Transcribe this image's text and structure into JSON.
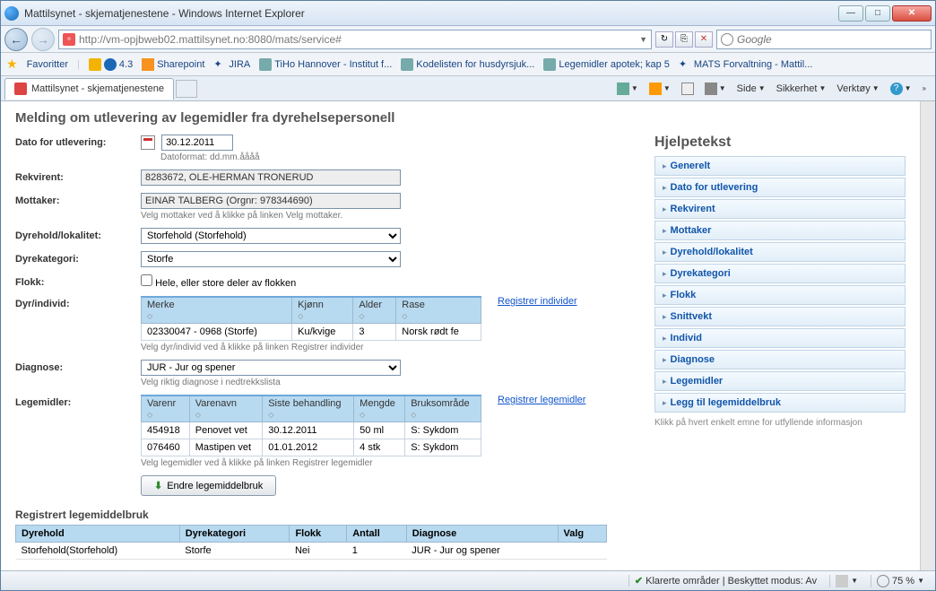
{
  "window": {
    "title": "Mattilsynet - skjematjenestene - Windows Internet Explorer",
    "url": "http://vm-opjbweb02.mattilsynet.no:8080/mats/service#",
    "search_placeholder": "Google"
  },
  "bookmarks": {
    "fav_label": "Favoritter",
    "items": [
      "4.3",
      "Sharepoint",
      "JIRA",
      "TiHo Hannover - Institut f...",
      "Kodelisten for husdyrsjuk...",
      "Legemidler apotek; kap 5",
      "MATS Forvaltning - Mattil..."
    ]
  },
  "tab": {
    "title": "Mattilsynet - skjematjenestene"
  },
  "toolbar": {
    "items": [
      "Side",
      "Sikkerhet",
      "Verktøy"
    ]
  },
  "page": {
    "title": "Melding om utlevering av legemidler fra dyrehelsepersonell",
    "labels": {
      "dato": "Dato for utlevering:",
      "dato_value": "30.12.2011",
      "dato_help": "Datoformat: dd.mm.åååå",
      "rekvirent": "Rekvirent:",
      "rekvirent_value": "8283672, OLE-HERMAN TRONERUD",
      "mottaker": "Mottaker:",
      "mottaker_value": "EINAR TALBERG (Orgnr: 978344690)",
      "mottaker_help": "Velg mottaker ved å klikke på linken Velg mottaker.",
      "dyrehold": "Dyrehold/lokalitet:",
      "dyrehold_value": "Storfehold (Storfehold)",
      "kategori": "Dyrekategori:",
      "kategori_value": "Storfe",
      "flokk": "Flokk:",
      "flokk_text": "Hele, eller store deler av flokken",
      "individ": "Dyr/individ:",
      "individ_link": "Registrer individer",
      "individ_help": "Velg dyr/individ ved å klikke på linken Registrer individer",
      "diagnose": "Diagnose:",
      "diagnose_value": "JUR - Jur og spener",
      "diagnose_help": "Velg riktig diagnose i nedtrekkslista",
      "legemidler": "Legemidler:",
      "legemidler_link": "Registrer legemidler",
      "legemidler_help": "Velg legemidler ved å klikke på linken Registrer legemidler",
      "endre_btn": "Endre legemiddelbruk",
      "registrert_head": "Registrert legemiddelbruk"
    },
    "individ_table": {
      "headers": [
        "Merke",
        "Kjønn",
        "Alder",
        "Rase"
      ],
      "rows": [
        [
          "02330047 - 0968 (Storfe)",
          "Ku/kvige",
          "3",
          "Norsk rødt fe"
        ]
      ]
    },
    "legemidler_table": {
      "headers": [
        "Varenr",
        "Varenavn",
        "Siste behandling",
        "Mengde",
        "Bruksområde"
      ],
      "rows": [
        [
          "454918",
          "Penovet vet",
          "30.12.2011",
          "50 ml",
          "S: Sykdom"
        ],
        [
          "076460",
          "Mastipen vet",
          "01.01.2012",
          "4 stk",
          "S: Sykdom"
        ]
      ]
    },
    "reg_table": {
      "headers": [
        "Dyrehold",
        "Dyrekategori",
        "Flokk",
        "Antall",
        "Diagnose",
        "Valg"
      ],
      "rows": [
        [
          "Storfehold(Storfehold)",
          "Storfe",
          "Nei",
          "1",
          "JUR - Jur og spener",
          ""
        ]
      ]
    }
  },
  "help": {
    "title": "Hjelpetekst",
    "items": [
      "Generelt",
      "Dato for utlevering",
      "Rekvirent",
      "Mottaker",
      "Dyrehold/lokalitet",
      "Dyrekategori",
      "Flokk",
      "Snittvekt",
      "Individ",
      "Diagnose",
      "Legemidler",
      "Legg til legemiddelbruk"
    ],
    "footer": "Klikk på hvert enkelt emne for utfyllende informasjon"
  },
  "status": {
    "zone": "Klarerte områder | Beskyttet modus: Av",
    "zoom": "75 %"
  }
}
